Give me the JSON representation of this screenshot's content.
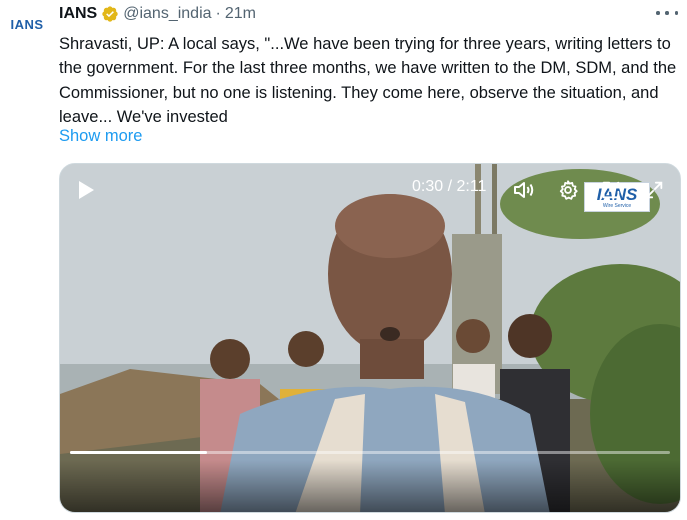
{
  "tweet": {
    "avatar_text": "IANS",
    "author_name": "IANS",
    "handle": "@ians_india",
    "separator": "·",
    "time_ago": "21m",
    "text": "Shravasti, UP: A local says, \"...We have been trying for three years, writing letters to the government. For the last three months, we have written to the DM, SDM, and the Commissioner, but no one is listening. They come here, observe the situation, and leave... We've invested",
    "show_more_label": "Show more"
  },
  "media": {
    "watermark_title": "IANS",
    "watermark_subtitle": "Wire Service",
    "current_time": "0:30",
    "time_separator": " / ",
    "duration": "2:11",
    "progress_fraction": 0.229
  },
  "colors": {
    "accent": "#1d9bf0",
    "verified_badge": "#e2b719",
    "brand": "#1f5fa8",
    "secondary_text": "#536471"
  },
  "icons": [
    "verified-badge-icon",
    "more-options-icon",
    "play-icon",
    "volume-icon",
    "settings-icon",
    "pip-icon",
    "fullscreen-icon"
  ]
}
